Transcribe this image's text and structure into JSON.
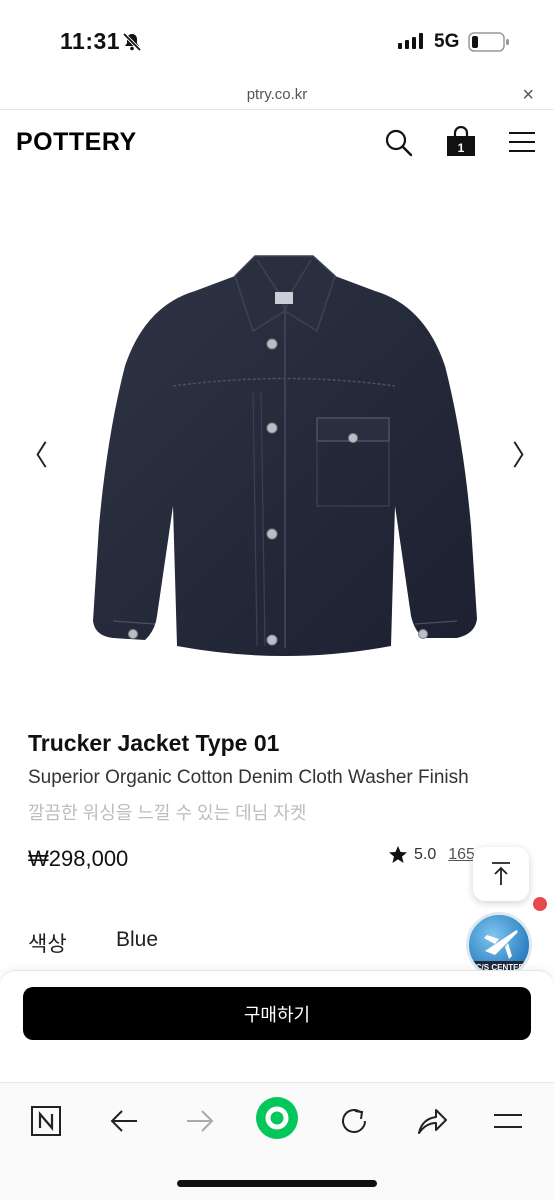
{
  "status_bar": {
    "time": "11:31",
    "network": "5G",
    "bell_icon": "bell-slash-icon",
    "signal_icon": "signal-bars-icon",
    "battery_icon": "battery-low-icon"
  },
  "browser": {
    "url": "ptry.co.kr",
    "close_symbol": "×"
  },
  "header": {
    "logo": "POTTERY",
    "cart_count": "1",
    "icons": [
      "search-icon",
      "cart-bag-icon",
      "menu-hamburger-icon"
    ]
  },
  "gallery": {
    "prev_symbol": "〈",
    "next_symbol": "〉",
    "image_icon": "denim-jacket-image"
  },
  "product": {
    "title": "Trucker Jacket Type 01",
    "subtitle": "Superior Organic Cotton Denim Cloth Washer Finish",
    "description_kr": "깔끔한 워싱을 느낄 수 있는 데님 자켓",
    "price": "₩298,000",
    "rating": "5.0",
    "reviews": "165"
  },
  "options": {
    "color_label": "색상",
    "color_value": "Blue"
  },
  "floating": {
    "cs_label": "C/S CENTER",
    "scroll_top_icon": "arrow-up-to-top-icon"
  },
  "actions": {
    "buy_label": "구매하기"
  },
  "toolbar": {
    "items": [
      "naver-n-icon",
      "back-arrow-icon",
      "forward-arrow-icon",
      "green-home-icon",
      "reload-icon",
      "share-icon",
      "menu-icon"
    ]
  },
  "colors": {
    "accent_green": "#03c75a",
    "buy_button": "#000000",
    "red_dot": "#e5484d"
  }
}
